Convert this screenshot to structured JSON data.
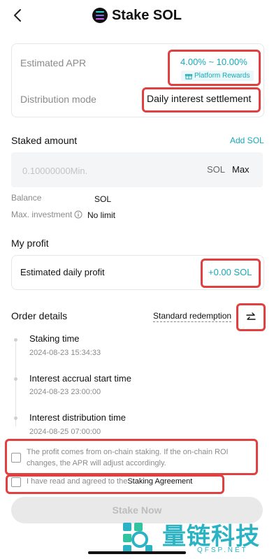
{
  "header": {
    "title": "Stake SOL"
  },
  "apr": {
    "label": "Estimated APR",
    "value": "4.00% ~ 10.00%",
    "badge": "Platform Rewards"
  },
  "distribution": {
    "label": "Distribution mode",
    "value": "Daily interest settlement"
  },
  "staked": {
    "title": "Staked amount",
    "add_link": "Add SOL",
    "placeholder": "0.10000000Min.",
    "unit": "SOL",
    "max_label": "Max"
  },
  "balance": {
    "label": "Balance",
    "value": "SOL"
  },
  "max_investment": {
    "label": "Max. investment",
    "value": "No limit"
  },
  "profit": {
    "title": "My profit",
    "label": "Estimated daily profit",
    "value": "+0.00 SOL"
  },
  "order": {
    "title": "Order details",
    "mode": "Standard redemption",
    "steps": [
      {
        "label": "Staking time",
        "time": "2024-08-23 15:34:33"
      },
      {
        "label": "Interest accrual start time",
        "time": "2024-08-23 23:00:00"
      },
      {
        "label": "Interest distribution time",
        "time": "2024-08-25 07:00:00"
      }
    ]
  },
  "notice": {
    "text": "The profit comes from on-chain staking. If the on-chain ROI changes, the APR will adjust accordingly."
  },
  "agreement": {
    "prefix": "I have read and agreed to the",
    "link": "Staking Agreement"
  },
  "stake_button": "Stake Now",
  "watermark": {
    "cn": "量链科技",
    "url": "QFSP.NET"
  },
  "colors": {
    "accent": "#16a9b8",
    "highlight": "#e0403f"
  },
  "icons": [
    "chevron-left-icon",
    "solana-logo-icon",
    "gift-icon",
    "info-icon",
    "swap-icon"
  ]
}
